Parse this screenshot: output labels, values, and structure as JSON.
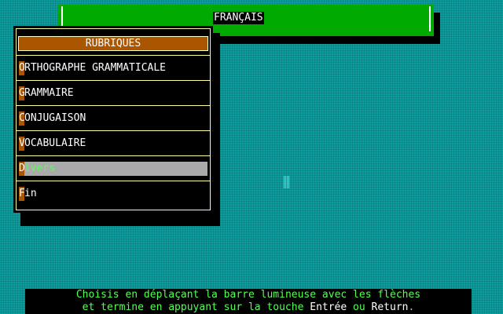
{
  "title": "FRANÇAIS",
  "menu": {
    "header": "RUBRIQUES",
    "items": [
      {
        "hotkey": "O",
        "rest": "RTHOGRAPHE GRAMMATICALE"
      },
      {
        "hotkey": "G",
        "rest": "RAMMAIRE"
      },
      {
        "hotkey": "C",
        "rest": "ONJUGAISON"
      },
      {
        "hotkey": "V",
        "rest": "OCABULAIRE"
      },
      {
        "hotkey": "D",
        "rest": "ivers",
        "selected": true
      },
      {
        "hotkey": "F",
        "rest": "in"
      }
    ]
  },
  "footer": {
    "line1": "Choisis en déplaçant la barre lumineuse avec les flèches",
    "line2_a": "et termine en appuyant sur la touche ",
    "key1": "Entrée",
    "line2_b": " ou ",
    "key2": "Return",
    "line2_c": "."
  },
  "colors": {
    "background": "#0e9a9a",
    "title_bar": "#00aa00",
    "menu_header": "#aa5500",
    "selection_bar": "#aaaaaa",
    "hint_text": "#55ff55"
  }
}
